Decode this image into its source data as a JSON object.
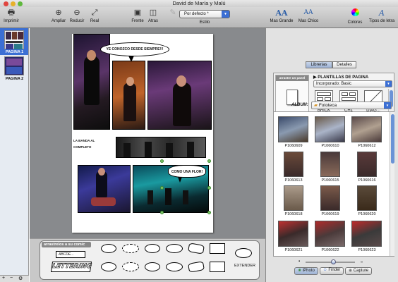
{
  "window": {
    "title": "David de María y Malú"
  },
  "toolbar": {
    "print": "Imprimir",
    "zoom_in": "Ampliar",
    "zoom_out": "Reducir",
    "real": "Real",
    "front": "Frente",
    "back": "Atras",
    "style_value": "Por defecto *",
    "style_label": "Estilo",
    "bigger": "Mas Grande",
    "smaller": "Mas Chico",
    "colors": "Colores",
    "fonts": "Tipos de letra",
    "font_icon_big": "AA",
    "font_icon_small": "AA",
    "fonts_icon": "A"
  },
  "sidebar": {
    "pages": [
      {
        "label": "PAGINA 1"
      },
      {
        "label": "PAGINA 2"
      }
    ],
    "add": "+",
    "remove": "−",
    "gear": "⚙"
  },
  "comic": {
    "bubble1": "YE CONOZCO DESDE SIEMPRE!!!",
    "caption": "LA BANDA AL COMPLETO",
    "bubble2": "COMO UNA FLOR!"
  },
  "tray": {
    "title": "arrastrelos a su comic",
    "abcde": "ABCDE...",
    "lettering": "LETTERING",
    "extend": "EXTENDER"
  },
  "right": {
    "tabs": [
      {
        "label": "Librerias",
        "selected": true
      },
      {
        "label": "Detalles",
        "selected": false
      }
    ],
    "drag_hint": "arrastre un panel",
    "templates_title": "PLANTILLAS DE PAGINA",
    "templates_select": "Incorporado: Basic",
    "templates": [
      "BRICK",
      "CH1",
      "DIAG..."
    ],
    "album_label": "ALBUM:",
    "album_value": "Fototeca",
    "photos": [
      "P1060609",
      "P1060610",
      "P1060612",
      "P1060613",
      "P1060615",
      "P1060616",
      "P1060618",
      "P1060619",
      "P1060620",
      "P1060621",
      "P1060622",
      "P1060623"
    ],
    "bottom_tabs": [
      {
        "label": "iPhoto"
      },
      {
        "label": "Finder"
      },
      {
        "label": "Capture"
      }
    ]
  },
  "colors": {
    "selection": "#3b6fd4",
    "toolbar": "#c4c4c4"
  }
}
